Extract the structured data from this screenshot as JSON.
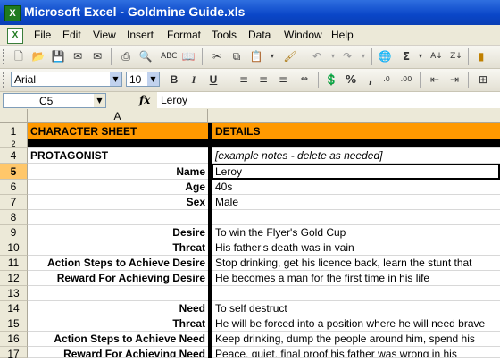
{
  "window": {
    "title": "Microsoft Excel - Goldmine Guide.xls"
  },
  "menu": [
    "File",
    "Edit",
    "View",
    "Insert",
    "Format",
    "Tools",
    "Data",
    "Window",
    "Help"
  ],
  "toolbar": {
    "font_name": "Arial",
    "font_size": "10"
  },
  "formula_bar": {
    "name_box": "C5",
    "fx": "fx",
    "value": "Leroy"
  },
  "columns": [
    "A"
  ],
  "rows": [
    {
      "num": "1",
      "a": "CHARACTER SHEET",
      "b": "DETAILS"
    },
    {
      "num": "2",
      "a": "",
      "b": ""
    },
    {
      "num": "4",
      "a": "PROTAGONIST",
      "b": "[example notes - delete as needed]"
    },
    {
      "num": "5",
      "a": "Name",
      "b": "Leroy"
    },
    {
      "num": "6",
      "a": "Age",
      "b": "40s"
    },
    {
      "num": "7",
      "a": "Sex",
      "b": "Male"
    },
    {
      "num": "8",
      "a": "",
      "b": ""
    },
    {
      "num": "9",
      "a": "Desire",
      "b": "To win the Flyer's Gold Cup"
    },
    {
      "num": "10",
      "a": "Threat",
      "b": "His father's death was in vain"
    },
    {
      "num": "11",
      "a": "Action Steps to Achieve Desire",
      "b": "Stop drinking, get his licence back, learn the stunt that"
    },
    {
      "num": "12",
      "a": "Reward For Achieving Desire",
      "b": "He becomes a man for the first time in his life"
    },
    {
      "num": "13",
      "a": "",
      "b": ""
    },
    {
      "num": "14",
      "a": "Need",
      "b": "To self destruct"
    },
    {
      "num": "15",
      "a": "Threat",
      "b": "He will be forced into a position where he will need brave"
    },
    {
      "num": "16",
      "a": "Action Steps to Achieve Need",
      "b": "Keep drinking, dump the people around him, spend his"
    },
    {
      "num": "17",
      "a": "Reward For Achieving Need",
      "b": "Peace, quiet, final proof his father was wrong in his"
    }
  ],
  "colors": {
    "header_orange": "#ff9900",
    "selected_row": "#ffc76a",
    "title_blue": "#0a46c8"
  }
}
